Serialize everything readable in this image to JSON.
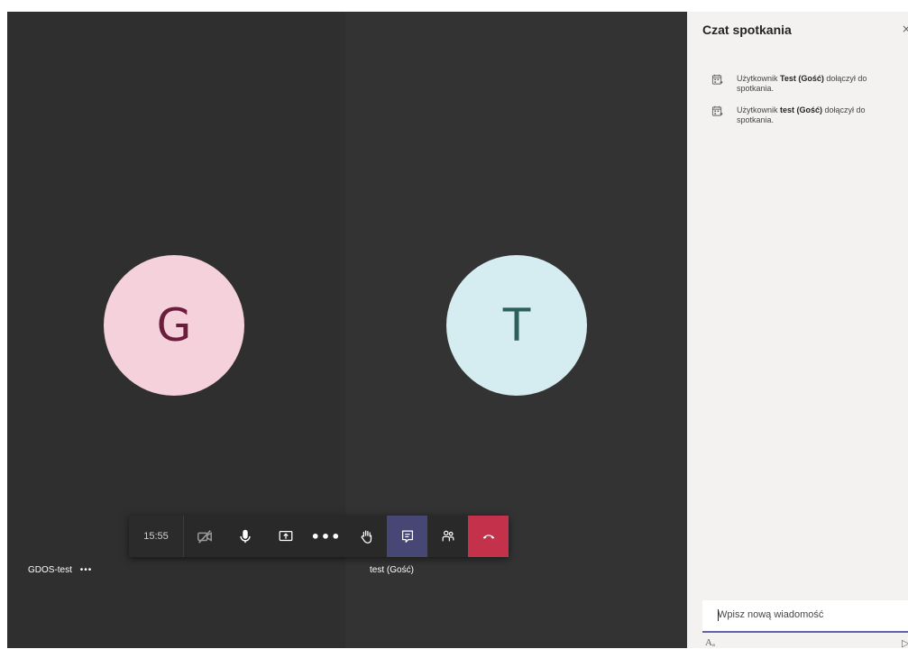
{
  "meeting": {
    "participants": [
      {
        "initial": "G",
        "name": "GDOS-test",
        "more": "•••",
        "avatar_bg": "#f5d1dc",
        "avatar_fg": "#6b1d3b"
      },
      {
        "initial": "T",
        "name": "test (Gość)",
        "avatar_bg": "#d5ecf0",
        "avatar_fg": "#2e5f5c"
      }
    ],
    "controls": {
      "timer": "15:55",
      "video_icon": "video-off-icon",
      "mic_icon": "microphone-icon",
      "share_icon": "share-screen-icon",
      "more_label": "•••",
      "hand_icon": "raise-hand-icon",
      "chat_icon": "chat-icon",
      "participants_icon": "participants-icon",
      "hangup_icon": "hang-up-icon"
    },
    "colors": {
      "stage_bg": "#2e2e2e",
      "chat_active": "#464775",
      "hangup": "#c4314b",
      "accent": "#6264a7"
    }
  },
  "chat_panel": {
    "title": "Czat spotkania",
    "close": "×",
    "messages": [
      {
        "prefix": "Użytkownik ",
        "name": "Test (Gość)",
        "suffix": " dołączył do spotkania."
      },
      {
        "prefix": "Użytkownik ",
        "name": "test (Gość)",
        "suffix": " dołączył do spotkania."
      }
    ],
    "compose": {
      "placeholder": "Wpisz nową wiadomość",
      "format_label": "Aₐ",
      "send_label": "▷"
    }
  }
}
